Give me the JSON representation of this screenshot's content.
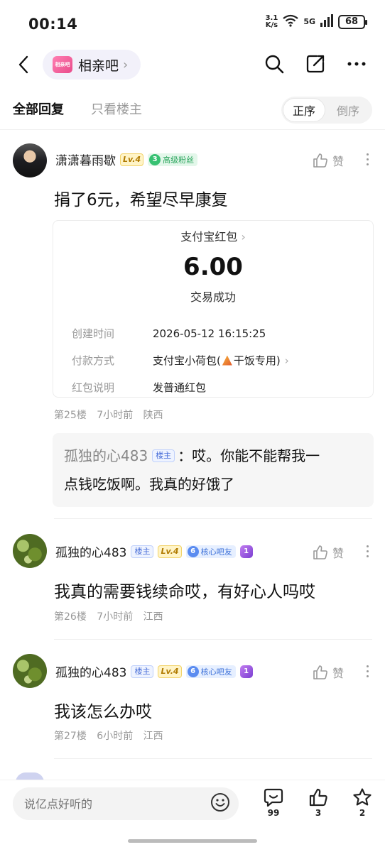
{
  "status_bar": {
    "time": "00:14",
    "net_speed_top": "3.1",
    "net_speed_unit": "K/s",
    "signal_label": "5G",
    "battery": "68"
  },
  "header": {
    "forum_logo_text": "相亲吧",
    "forum_name": "相亲吧"
  },
  "tabs": {
    "all_replies": "全部回复",
    "only_op": "只看楼主",
    "order_asc": "正序",
    "order_desc": "倒序"
  },
  "posts": [
    {
      "username": "潇潇暮雨歇",
      "level": "Lv.4",
      "fan_level": "3",
      "fan_title": "高级粉丝",
      "like_label": "赞",
      "content": "捐了6元，希望尽早康复",
      "payment": {
        "title": "支付宝红包",
        "amount": "6.00",
        "status": "交易成功",
        "rows": [
          {
            "label": "创建时间",
            "value": "2026-05-12 16:15:25"
          },
          {
            "label": "付款方式",
            "value_pre": "支付宝小荷包(",
            "value_post": "干饭专用)"
          },
          {
            "label": "红包说明",
            "value": "发普通红包"
          }
        ]
      },
      "floor": "第25楼",
      "time": "7小时前",
      "location": "陕西",
      "quote": {
        "name": "孤独的心483",
        "owner_badge": "楼主",
        "text_line1": "：哎。你能不能帮我一",
        "text_line2": "点钱吃饭啊。我真的好饿了"
      }
    },
    {
      "username": "孤独的心483",
      "owner_badge": "楼主",
      "level": "Lv.4",
      "fan_level": "6",
      "fan_title": "核心吧友",
      "medal": "1",
      "like_label": "赞",
      "content": "我真的需要钱续命哎，有好心人吗哎",
      "floor": "第26楼",
      "time": "7小时前",
      "location": "江西"
    },
    {
      "username": "孤独的心483",
      "owner_badge": "楼主",
      "level": "Lv.4",
      "fan_level": "6",
      "fan_title": "核心吧友",
      "medal": "1",
      "like_label": "赞",
      "content": "我该怎么办哎",
      "floor": "第27楼",
      "time": "6小时前",
      "location": "江西"
    }
  ],
  "bottom_bar": {
    "placeholder": "说亿点好听的",
    "comment_count": "99",
    "like_count": "3",
    "star_count": "2"
  }
}
